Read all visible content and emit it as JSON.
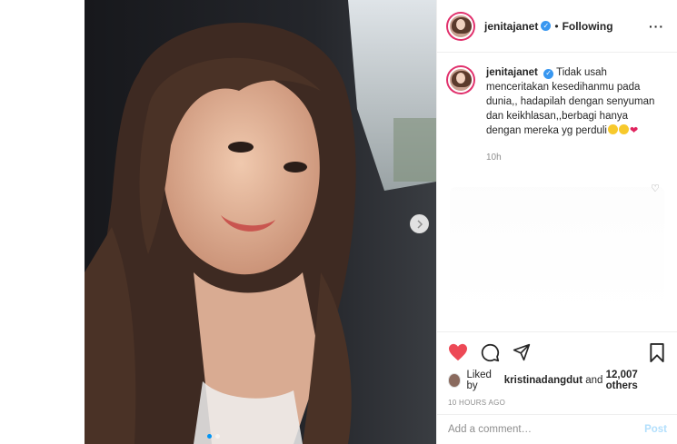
{
  "post": {
    "username": "jenitajanet",
    "follow_status": "Following",
    "separator": "•",
    "more_icon": "more-horizontal-icon",
    "caption": {
      "username": "jenitajanet",
      "text": "Tidak usah menceritakan kesedihanmu pada dunia,, hadapilah dengan senyuman dan keikhlasan,,berbagi hanya dengan mereka yg perduli",
      "time": "10h"
    },
    "likes": {
      "prefix": "Liked by",
      "user": "kristinadangdut",
      "middle": "and",
      "count": "12,007 others"
    },
    "time_ago": "10 HOURS AGO",
    "comment_box": {
      "placeholder": "Add a comment…",
      "post_label": "Post"
    }
  },
  "colors": {
    "like_red": "#ed4956",
    "verified_blue": "#3897f0",
    "post_disabled": "#b2dffc",
    "accent": "#0095f6"
  },
  "icons": [
    "heart-icon",
    "comment-icon",
    "share-icon",
    "bookmark-icon",
    "verified-icon",
    "chevron-right-icon"
  ]
}
